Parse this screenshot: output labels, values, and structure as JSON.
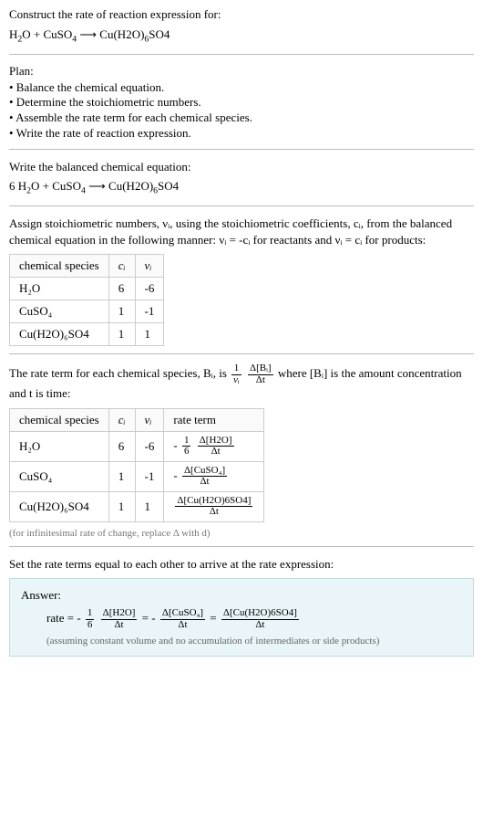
{
  "prompt": {
    "title": "Construct the rate of reaction expression for:",
    "equation_lhs_h2o": "H",
    "equation_lhs_h2o_sub": "2",
    "equation_lhs_o": "O + CuSO",
    "equation_lhs_cuso4_sub": "4",
    "arrow": " ⟶ Cu(H",
    "equation_rhs_mid": "O)",
    "equation_rhs_6": "6",
    "equation_rhs_so4": "SO4"
  },
  "plan": {
    "title": "Plan:",
    "item1": "• Balance the chemical equation.",
    "item2": "• Determine the stoichiometric numbers.",
    "item3": "• Assemble the rate term for each chemical species.",
    "item4": "• Write the rate of reaction expression."
  },
  "balanced": {
    "title": "Write the balanced chemical equation:",
    "prefix": "6 H",
    "h2o_sub": "2",
    "mid": "O + CuSO",
    "cuso4_sub": "4",
    "arrow": " ⟶ Cu(H",
    "rhs_o": "O)",
    "rhs_6": "6",
    "rhs_so4": "SO4"
  },
  "assign": {
    "text": "Assign stoichiometric numbers, νᵢ, using the stoichiometric coefficients, cᵢ, from the balanced chemical equation in the following manner: νᵢ = -cᵢ for reactants and νᵢ = cᵢ for products:"
  },
  "table1": {
    "h_species": "chemical species",
    "h_c": "cᵢ",
    "h_v": "νᵢ",
    "r1_species": "H₂O",
    "r1_c": "6",
    "r1_v": "-6",
    "r2_species": "CuSO₄",
    "r2_c": "1",
    "r2_v": "-1",
    "r3_species": "Cu(H2O)₆SO4",
    "r3_c": "1",
    "r3_v": "1"
  },
  "rateterm": {
    "pre": "The rate term for each chemical species, Bᵢ, is ",
    "frac1_num": "1",
    "frac1_den": "νᵢ",
    "frac2_num": "Δ[Bᵢ]",
    "frac2_den": "Δt",
    "post": " where [Bᵢ] is the amount concentration and t is time:"
  },
  "table2": {
    "h_species": "chemical species",
    "h_c": "cᵢ",
    "h_v": "νᵢ",
    "h_rate": "rate term",
    "r1_species": "H₂O",
    "r1_c": "6",
    "r1_v": "-6",
    "r1_neg": "-",
    "r1_f1n": "1",
    "r1_f1d": "6",
    "r1_f2n": "Δ[H2O]",
    "r1_f2d": "Δt",
    "r2_species": "CuSO₄",
    "r2_c": "1",
    "r2_v": "-1",
    "r2_neg": "-",
    "r2_fn": "Δ[CuSO₄]",
    "r2_fd": "Δt",
    "r3_species": "Cu(H2O)₆SO4",
    "r3_c": "1",
    "r3_v": "1",
    "r3_fn": "Δ[Cu(H2O)6SO4]",
    "r3_fd": "Δt"
  },
  "infinitesimal_note": "(for infinitesimal rate of change, replace Δ with d)",
  "set_equal": "Set the rate terms equal to each other to arrive at the rate expression:",
  "answer": {
    "title": "Answer:",
    "rate_label": "rate = ",
    "neg1": "-",
    "f1n": "1",
    "f1d": "6",
    "f2n": "Δ[H2O]",
    "f2d": "Δt",
    "eq": " = ",
    "neg2": "-",
    "f3n": "Δ[CuSO₄]",
    "f3d": "Δt",
    "f4n": "Δ[Cu(H2O)6SO4]",
    "f4d": "Δt",
    "note": "(assuming constant volume and no accumulation of intermediates or side products)"
  },
  "chart_data": {
    "type": "table",
    "tables": [
      {
        "title": "Stoichiometric numbers",
        "columns": [
          "chemical species",
          "c_i",
          "ν_i"
        ],
        "rows": [
          [
            "H2O",
            6,
            -6
          ],
          [
            "CuSO4",
            1,
            -1
          ],
          [
            "Cu(H2O)6SO4",
            1,
            1
          ]
        ]
      },
      {
        "title": "Rate terms",
        "columns": [
          "chemical species",
          "c_i",
          "ν_i",
          "rate term"
        ],
        "rows": [
          [
            "H2O",
            6,
            -6,
            "-(1/6)(Δ[H2O]/Δt)"
          ],
          [
            "CuSO4",
            1,
            -1,
            "-(Δ[CuSO4]/Δt)"
          ],
          [
            "Cu(H2O)6SO4",
            1,
            1,
            "(Δ[Cu(H2O)6SO4]/Δt)"
          ]
        ]
      }
    ]
  }
}
